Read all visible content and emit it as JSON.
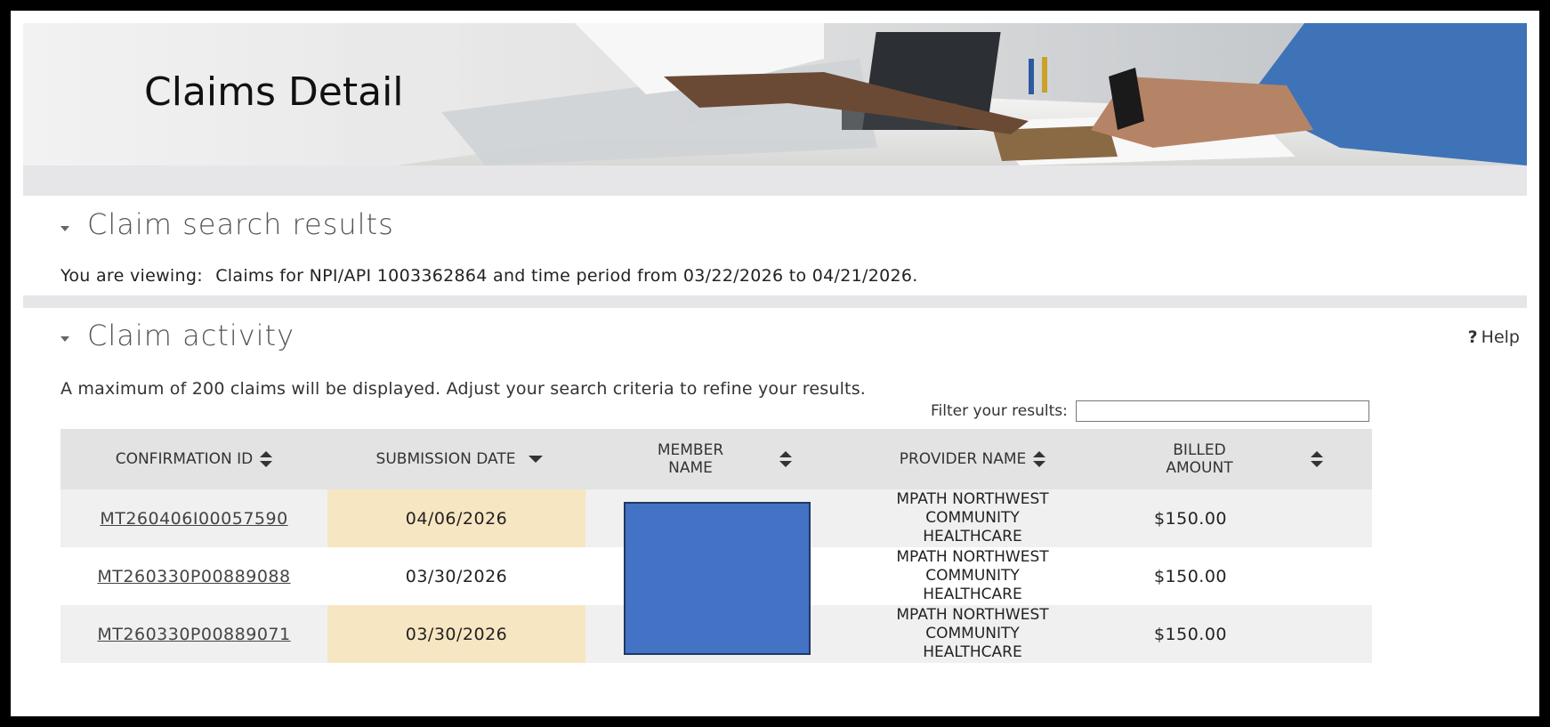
{
  "banner": {
    "title": "Claims Detail"
  },
  "search_results": {
    "title": "Claim search results",
    "viewing_label": "You are viewing:",
    "viewing_text": "Claims for NPI/API 1003362864 and time period from 03/22/2026 to 04/21/2026."
  },
  "activity": {
    "title": "Claim activity",
    "help_label": "Help",
    "help_glyph": "?",
    "notice": "A maximum of 200 claims will be displayed. Adjust your search criteria to refine your results.",
    "filter_label": "Filter your results:",
    "filter_value": ""
  },
  "table": {
    "columns": [
      {
        "label": "CONFIRMATION ID",
        "sort": "both"
      },
      {
        "label": "SUBMISSION DATE",
        "sort": "desc"
      },
      {
        "label": "MEMBER NAME",
        "sort": "both"
      },
      {
        "label": "PROVIDER NAME",
        "sort": "both"
      },
      {
        "label": "BILLED AMOUNT",
        "sort": "both"
      }
    ],
    "rows": [
      {
        "confirmation_id": "MT260406I00057590",
        "submission_date": "04/06/2026",
        "member_name": "",
        "provider_line1": "MPATH NORTHWEST",
        "provider_line2": "COMMUNITY",
        "provider_line3": "HEALTHCARE",
        "billed_amount": "$150.00"
      },
      {
        "confirmation_id": "MT260330P00889088",
        "submission_date": "03/30/2026",
        "member_name": "",
        "provider_line1": "MPATH NORTHWEST",
        "provider_line2": "COMMUNITY",
        "provider_line3": "HEALTHCARE",
        "billed_amount": "$150.00"
      },
      {
        "confirmation_id": "MT260330P00889071",
        "submission_date": "03/30/2026",
        "member_name": "",
        "provider_line1": "MPATH NORTHWEST",
        "provider_line2": "COMMUNITY",
        "provider_line3": "HEALTHCARE",
        "billed_amount": "$150.00"
      }
    ]
  },
  "colors": {
    "highlight": "#f7e6c2",
    "header_bg": "#e3e3e3",
    "redaction": "#4472c4"
  }
}
